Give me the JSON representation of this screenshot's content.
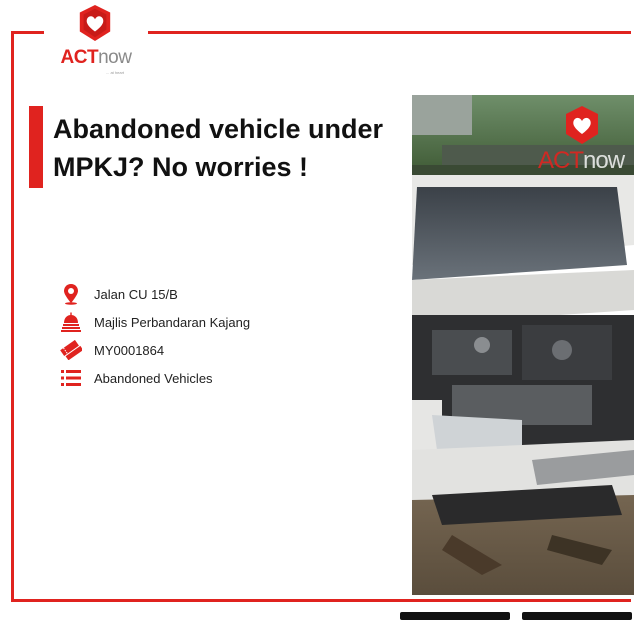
{
  "logo": {
    "act": "ACT",
    "now": "now",
    "tagline": "... at heart"
  },
  "title": {
    "line1": "Abandoned vehicle under",
    "line2": "MPKJ? No worries !"
  },
  "details": {
    "location": "Jalan CU 15/B",
    "agency": "Majlis Perbandaran Kajang",
    "ticket_id": "MY0001864",
    "category": "Abandoned Vehicles"
  },
  "photo_watermark": {
    "act": "ACT",
    "now": "now"
  },
  "icons": {
    "location": "map-pin-icon",
    "agency": "government-building-icon",
    "ticket": "ticket-icon",
    "category": "list-icon"
  },
  "colors": {
    "accent": "#e0231f",
    "text": "#111111",
    "muted": "#8a8a8a"
  }
}
